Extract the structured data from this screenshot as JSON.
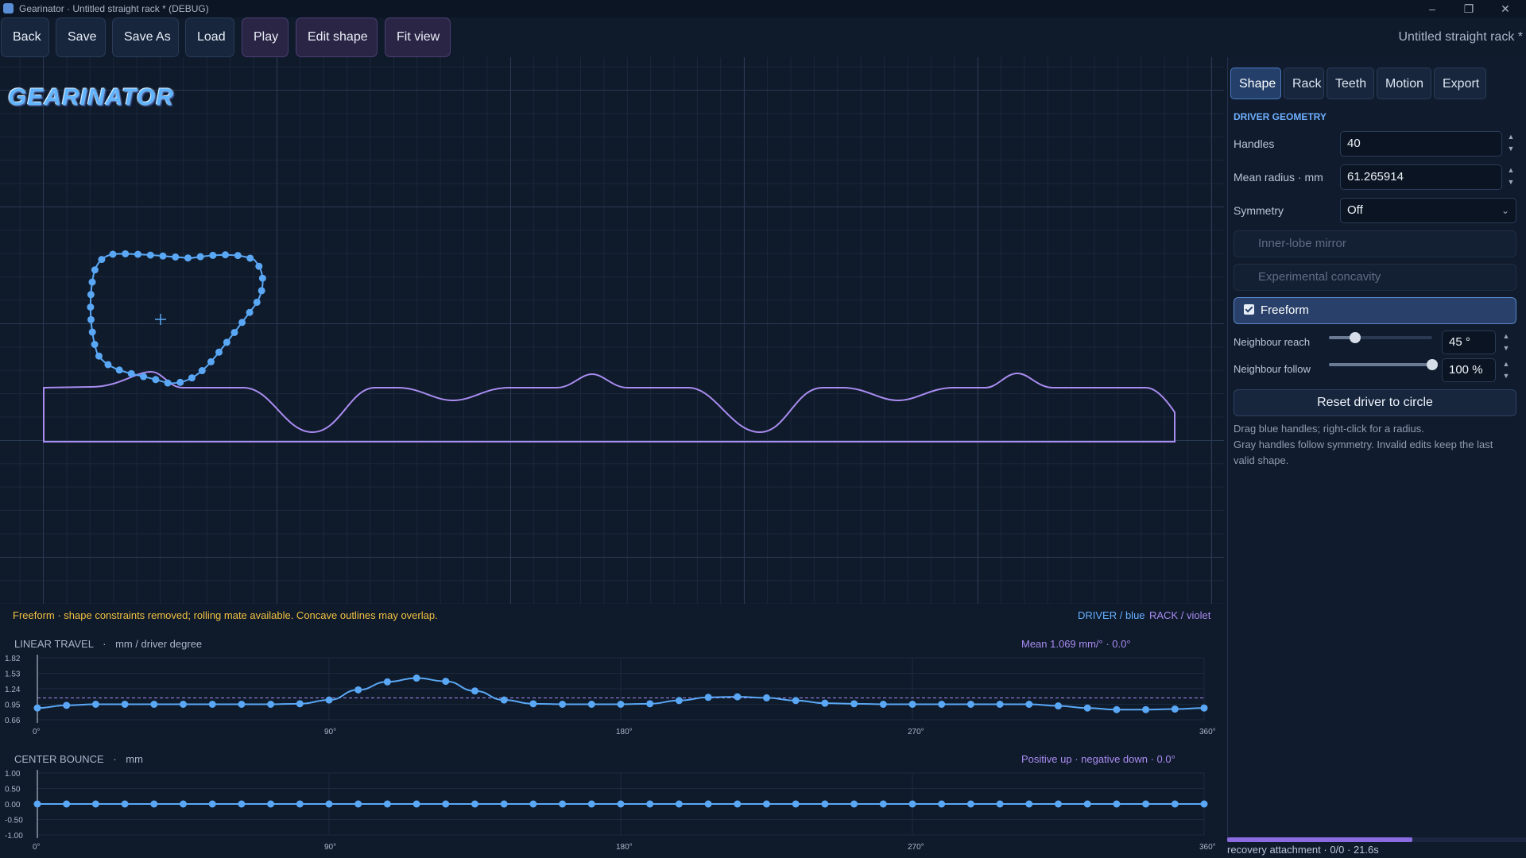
{
  "window": {
    "title": "Gearinator · Untitled straight rack * (DEBUG)",
    "controls": [
      "–",
      "❐",
      "✕"
    ]
  },
  "toolbar": {
    "back": "Back",
    "save": "Save",
    "save_as": "Save As",
    "load": "Load",
    "play": "Play",
    "edit_shape": "Edit shape",
    "fit_view": "Fit view",
    "document_name": "Untitled straight rack *"
  },
  "logo": {
    "text": "GEARINATOR"
  },
  "tabs": [
    "Shape",
    "Rack",
    "Teeth",
    "Motion",
    "Export"
  ],
  "active_tab": "Shape",
  "panel": {
    "section": "DRIVER GEOMETRY",
    "handles_label": "Handles",
    "handles_value": "40",
    "mean_radius_label": "Mean radius · mm",
    "mean_radius_value": "61.265914",
    "symmetry_label": "Symmetry",
    "symmetry_value": "Off",
    "inner_lobe_mirror": "Inner-lobe mirror",
    "experimental_concavity": "Experimental concavity",
    "freeform": "Freeform",
    "freeform_checked": true,
    "neighbour_reach_label": "Neighbour reach",
    "neighbour_reach_value": "45 °",
    "neighbour_reach_level": 0.25,
    "neighbour_follow_label": "Neighbour follow",
    "neighbour_follow_value": "100 %",
    "neighbour_follow_level": 1.0,
    "reset_button": "Reset driver to circle",
    "help_line1": "Drag blue handles; right-click for a radius.",
    "help_line2": "Gray handles follow symmetry. Invalid edits keep the last valid shape."
  },
  "status": {
    "message": "Freeform · shape constraints removed; rolling mate available. Concave outlines may overlap.",
    "legend_driver": "DRIVER / blue",
    "legend_rack": "RACK / violet",
    "recovery": "recovery attachment · 0/0 · 21.6s",
    "recovery_progress": 0.62
  },
  "colors": {
    "driver": "#5aa8f5",
    "rack": "#a98cf0",
    "status_warning": "#f0c040",
    "accent": "#6fb0ff"
  },
  "linear_travel": {
    "title": "LINEAR TRAVEL",
    "unit": "mm / driver degree",
    "info": "Mean 1.069 mm/° · 0.0°",
    "y_ticks": [
      "1.82",
      "1.53",
      "1.24",
      "0.95",
      "0.66"
    ],
    "x_ticks": [
      "0°",
      "90°",
      "180°",
      "270°",
      "360°"
    ],
    "chart_data": {
      "type": "line",
      "ylim": [
        0.66,
        1.82
      ],
      "xlim": [
        0,
        360
      ],
      "mean": 1.069,
      "x": [
        0,
        9,
        18,
        27,
        36,
        45,
        54,
        63,
        72,
        81,
        90,
        99,
        108,
        117,
        126,
        135,
        144,
        153,
        162,
        171,
        180,
        189,
        198,
        207,
        216,
        225,
        234,
        243,
        252,
        261,
        270,
        279,
        288,
        297,
        306,
        315,
        324,
        333,
        342,
        351,
        360
      ],
      "values": [
        0.88,
        0.93,
        0.95,
        0.95,
        0.95,
        0.95,
        0.95,
        0.95,
        0.95,
        0.96,
        1.03,
        1.22,
        1.37,
        1.44,
        1.38,
        1.2,
        1.03,
        0.96,
        0.95,
        0.95,
        0.95,
        0.96,
        1.02,
        1.08,
        1.09,
        1.07,
        1.02,
        0.97,
        0.96,
        0.95,
        0.95,
        0.95,
        0.95,
        0.95,
        0.95,
        0.92,
        0.88,
        0.85,
        0.85,
        0.86,
        0.88
      ]
    }
  },
  "center_bounce": {
    "title": "CENTER BOUNCE",
    "unit": "mm",
    "info": "Positive up · negative down · 0.0°",
    "y_ticks": [
      "1.00",
      "0.50",
      "0.00",
      "-0.50",
      "-1.00"
    ],
    "x_ticks": [
      "0°",
      "90°",
      "180°",
      "270°",
      "360°"
    ],
    "chart_data": {
      "type": "line",
      "ylim": [
        -1.0,
        1.0
      ],
      "xlim": [
        0,
        360
      ],
      "x": [
        0,
        9,
        18,
        27,
        36,
        45,
        54,
        63,
        72,
        81,
        90,
        99,
        108,
        117,
        126,
        135,
        144,
        153,
        162,
        171,
        180,
        189,
        198,
        207,
        216,
        225,
        234,
        243,
        252,
        261,
        270,
        279,
        288,
        297,
        306,
        315,
        324,
        333,
        342,
        351,
        360
      ],
      "values": [
        0,
        0,
        0,
        0,
        0,
        0,
        0,
        0,
        0,
        0,
        0,
        0,
        0,
        0,
        0,
        0,
        0,
        0,
        0,
        0,
        0,
        0,
        0,
        0,
        0,
        0,
        0,
        0,
        0,
        0,
        0,
        0,
        0,
        0,
        0,
        0,
        0,
        0,
        0,
        0,
        0
      ]
    }
  }
}
